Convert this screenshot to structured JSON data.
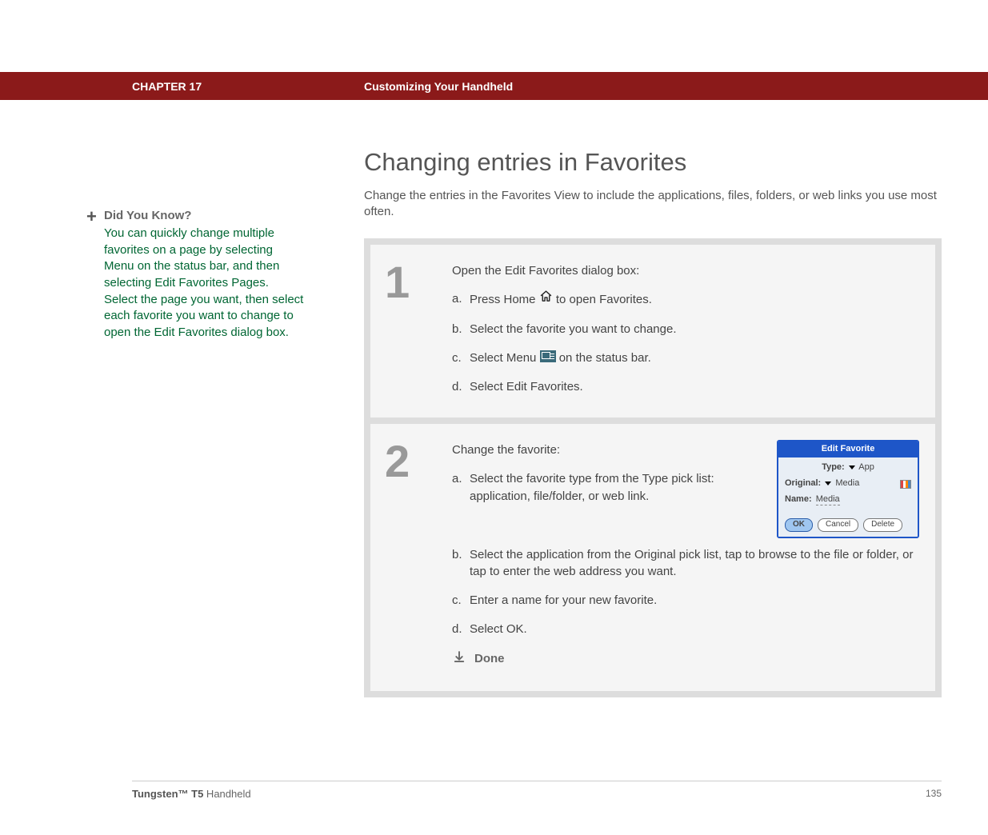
{
  "header": {
    "chapter": "CHAPTER 17",
    "title": "Customizing Your Handheld"
  },
  "sidebar": {
    "dyk_title": "Did You Know?",
    "dyk_body": "You can quickly change multiple favorites on a page by selecting Menu on the status bar, and then selecting Edit Favorites Pages. Select the page you want, then select each favorite you want to change to open the Edit Favorites dialog box."
  },
  "main": {
    "title": "Changing entries in Favorites",
    "intro": "Change the entries in the Favorites View to include the applications, files, folders, or web links you use most often."
  },
  "steps": [
    {
      "num": "1",
      "lead": "Open the Edit Favorites dialog box:",
      "subs": {
        "a_pre": "Press Home ",
        "a_post": " to open Favorites.",
        "b": "Select the favorite you want to change.",
        "c_pre": "Select Menu ",
        "c_post": " on the status bar.",
        "d": "Select Edit Favorites."
      }
    },
    {
      "num": "2",
      "lead": "Change the favorite:",
      "subs": {
        "a": "Select the favorite type from the Type pick list: application, file/folder, or web link.",
        "b": "Select the application from the Original pick list, tap to browse to the file or folder, or tap to enter the web address you want.",
        "c": "Enter a name for your new favorite.",
        "d": "Select OK."
      },
      "done": "Done"
    }
  ],
  "dialog": {
    "title": "Edit Favorite",
    "type_label": "Type:",
    "type_value": "App",
    "original_label": "Original:",
    "original_value": "Media",
    "name_label": "Name:",
    "name_value": "Media",
    "ok": "OK",
    "cancel": "Cancel",
    "delete": "Delete"
  },
  "footer": {
    "product_bold": "Tungsten™ T5",
    "product_rest": " Handheld",
    "page": "135"
  }
}
